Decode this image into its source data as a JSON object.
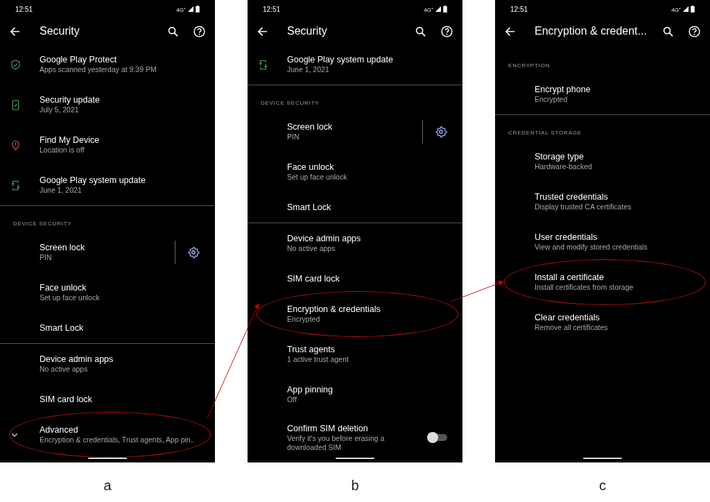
{
  "panels": [
    {
      "status": {
        "time": "12:51",
        "network": "4G⁺"
      },
      "title": "Security",
      "caption": "a",
      "list": [
        {
          "kind": "protect",
          "color": "#3f8f4f",
          "title": "Google Play Protect",
          "subtitle": "Apps scanned yesterday at 9:39 PM",
          "highlighted": false
        },
        {
          "kind": "patch",
          "color": "#3f8f4f",
          "title": "Security update",
          "subtitle": "July 5, 2021",
          "highlighted": false
        },
        {
          "kind": "locate",
          "color": "#c0503f",
          "title": "Find My Device",
          "subtitle": "Location is off",
          "highlighted": false
        },
        {
          "kind": "sync",
          "color": "#3f8f4f",
          "title": "Google Play system update",
          "subtitle": "June 1, 2021",
          "highlighted": false
        },
        {
          "kind": "divider"
        },
        {
          "kind": "header",
          "title": "DEVICE SECURITY"
        },
        {
          "kind": "lock",
          "title": "Screen lock",
          "subtitle": "PIN",
          "highlighted": false
        },
        {
          "kind": "item",
          "title": "Face unlock",
          "subtitle": "Set up face unlock",
          "highlighted": false
        },
        {
          "kind": "item",
          "title": "Smart Lock",
          "highlighted": false
        },
        {
          "kind": "divider"
        },
        {
          "kind": "item",
          "title": "Device admin apps",
          "subtitle": "No active apps",
          "highlighted": false
        },
        {
          "kind": "item",
          "title": "SIM card lock",
          "highlighted": false
        },
        {
          "kind": "expander",
          "expanded": false,
          "title": "Advanced",
          "subtitle": "Encryption & credentials, Trust agents, App pin..",
          "highlighted": true
        }
      ]
    },
    {
      "status": {
        "time": "12:51",
        "network": "4G⁺"
      },
      "title": "Security",
      "caption": "b",
      "list": [
        {
          "kind": "sync",
          "color": "#3f8f4f",
          "title": "Google Play system update",
          "subtitle": "June 1, 2021",
          "highlighted": false
        },
        {
          "kind": "divider"
        },
        {
          "kind": "header",
          "title": "DEVICE SECURITY"
        },
        {
          "kind": "lock",
          "title": "Screen lock",
          "subtitle": "PIN",
          "highlighted": false
        },
        {
          "kind": "item",
          "title": "Face unlock",
          "subtitle": "Set up face unlock",
          "highlighted": false
        },
        {
          "kind": "item",
          "title": "Smart Lock",
          "highlighted": false
        },
        {
          "kind": "divider"
        },
        {
          "kind": "item",
          "title": "Device admin apps",
          "subtitle": "No active apps",
          "highlighted": false
        },
        {
          "kind": "item",
          "title": "SIM card lock",
          "highlighted": false
        },
        {
          "kind": "item",
          "title": "Encryption & credentials",
          "subtitle": "Encrypted",
          "highlighted": true
        },
        {
          "kind": "item",
          "title": "Trust agents",
          "subtitle": "1 active trust agent",
          "highlighted": false
        },
        {
          "kind": "item",
          "title": "App pinning",
          "subtitle": "Off",
          "highlighted": false
        },
        {
          "kind": "switch",
          "on": false,
          "title": "Confirm SIM deletion",
          "subtitle": "Verify it's you before erasing a downloaded SIM",
          "highlighted": false
        }
      ]
    },
    {
      "status": {
        "time": "12:51",
        "network": "4G⁺"
      },
      "title": "Encryption & credent...",
      "caption": "c",
      "list": [
        {
          "kind": "header",
          "title": "ENCRYPTION"
        },
        {
          "kind": "item",
          "title": "Encrypt phone",
          "subtitle": "Encrypted",
          "highlighted": false
        },
        {
          "kind": "divider"
        },
        {
          "kind": "header",
          "title": "CREDENTIAL STORAGE"
        },
        {
          "kind": "item",
          "title": "Storage type",
          "subtitle": "Hardware-backed",
          "highlighted": false
        },
        {
          "kind": "item",
          "title": "Trusted credentials",
          "subtitle": "Display trusted CA certificates",
          "highlighted": false
        },
        {
          "kind": "item",
          "title": "User credentials",
          "subtitle": "View and modify stored credentials",
          "highlighted": false
        },
        {
          "kind": "item",
          "title": "Install a certificate",
          "subtitle": "Install certificates from storage",
          "highlighted": true
        },
        {
          "kind": "item",
          "title": "Clear credentials",
          "subtitle": "Remove all certificates",
          "highlighted": false
        }
      ]
    }
  ]
}
